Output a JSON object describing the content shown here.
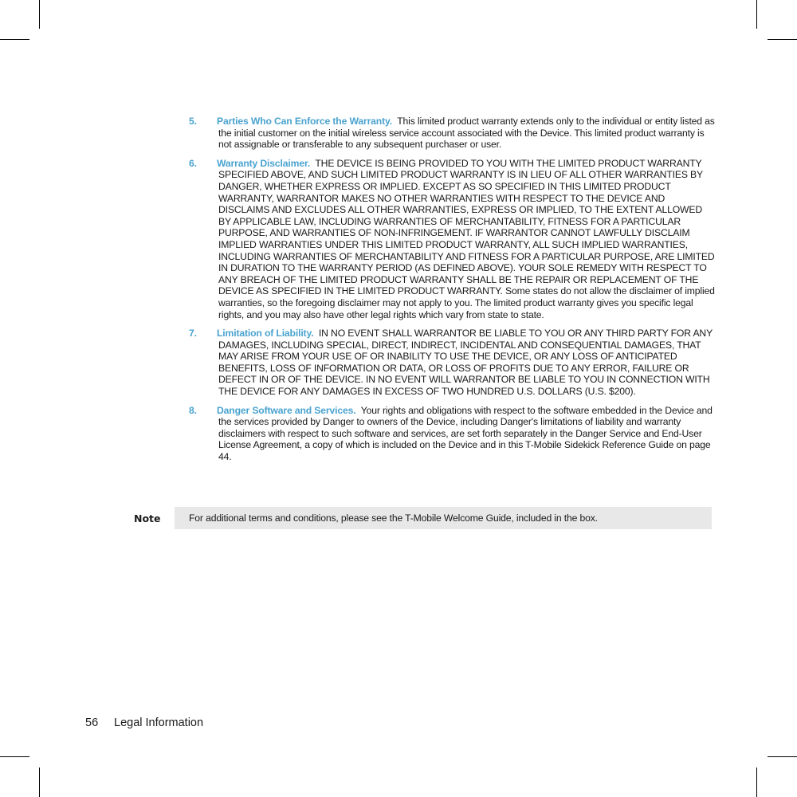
{
  "sections": [
    {
      "number": "5.",
      "heading": "Parties Who Can Enforce the Warranty.",
      "body": "This limited product warranty extends only to the individual or entity listed as the initial customer on the initial wireless service account associated with the Device.   This limited product warranty is not assignable or transferable to any subsequent purchaser or user."
    },
    {
      "number": "6.",
      "heading": "Warranty Disclaimer.",
      "body": "THE DEVICE IS BEING PROVIDED TO YOU WITH THE LIMITED PRODUCT WARRANTY SPECIFIED ABOVE, AND SUCH LIMITED PRODUCT WARRANTY IS IN LIEU OF ALL OTHER WARRANTIES BY DANGER, WHETHER EXPRESS OR IMPLIED.  EXCEPT AS SO SPECIFIED IN THIS LIMITED PRODUCT WARRANTY, WARRANTOR MAKES NO OTHER WARRANTIES WITH RESPECT TO THE DEVICE AND DISCLAIMS AND EXCLUDES ALL OTHER WARRANTIES, EXPRESS OR IMPLIED, TO THE EXTENT ALLOWED BY APPLICABLE LAW, INCLUDING WARRANTIES OF MERCHANTABILITY, FITNESS FOR A PARTICULAR PURPOSE, AND WARRANTIES OF NON-INFRINGEMENT.  IF WARRANTOR CANNOT LAWFULLY DISCLAIM IMPLIED WARRANTIES UNDER THIS LIMITED PRODUCT WARRANTY, ALL SUCH IMPLIED WARRANTIES, INCLUDING WARRANTIES  OF MERCHANTABILITY AND FITNESS FOR  A PARTICULAR PURPOSE, ARE LIMITED IN DURATION  TO THE WARRANTY PERIOD (AS DEFINED ABOVE). YOUR SOLE REMEDY WITH RESPECT TO ANY BREACH OF THE LIMITED PRODUCT WARRANTY SHALL BE THE REPAIR OR REPLACEMENT OF THE DEVICE AS SPECIFIED IN THE LIMITED PRODUCT WARRANTY.  Some states do not allow the disclaimer of implied warranties, so the foregoing disclaimer may not apply to you.  The limited product warranty gives you specific legal rights, and you may also have other legal rights which vary from state to state."
    },
    {
      "number": "7.",
      "heading": "Limitation of Liability.",
      "body": "IN NO EVENT SHALL WARRANTOR BE LIABLE TO YOU OR ANY THIRD PARTY FOR ANY DAMAGES, INCLUDING SPECIAL, DIRECT, INDIRECT, INCIDENTAL AND CONSEQUENTIAL DAMAGES, THAT MAY ARISE FROM YOUR USE OF OR INABILITY TO USE THE DEVICE, OR ANY LOSS OF ANTICIPATED BENEFITS, LOSS OF INFORMATION OR DATA, OR LOSS OF PROFITS DUE TO ANY ERROR, FAILURE OR DEFECT IN OR OF THE DEVICE.   IN NO EVENT WILL WARRANTOR BE LIABLE TO YOU IN CONNECTION WITH THE DEVICE FOR ANY DAMAGES IN EXCESS OF TWO HUNDRED U.S. DOLLARS (U.S. $200)."
    },
    {
      "number": "8.",
      "heading": "Danger Software and Services.",
      "body": "Your rights and obligations with respect to the software embedded in the Device and the services provided by Danger to owners of the Device, including Danger's limitations of liability and warranty disclaimers with respect to such software and services, are set forth separately in the Danger Service and End-User License Agreement, a copy of which is included on the Device and in this T-Mobile Sidekick Reference Guide on page 44."
    }
  ],
  "note": {
    "label": "Note",
    "text": "For additional terms and conditions, please see the T-Mobile Welcome Guide, included in the box."
  },
  "footer": {
    "page_number": "56",
    "section_title": "Legal Information"
  },
  "colors": {
    "heading_accent": "#4aa3cf",
    "note_background": "#e8e8e8"
  }
}
